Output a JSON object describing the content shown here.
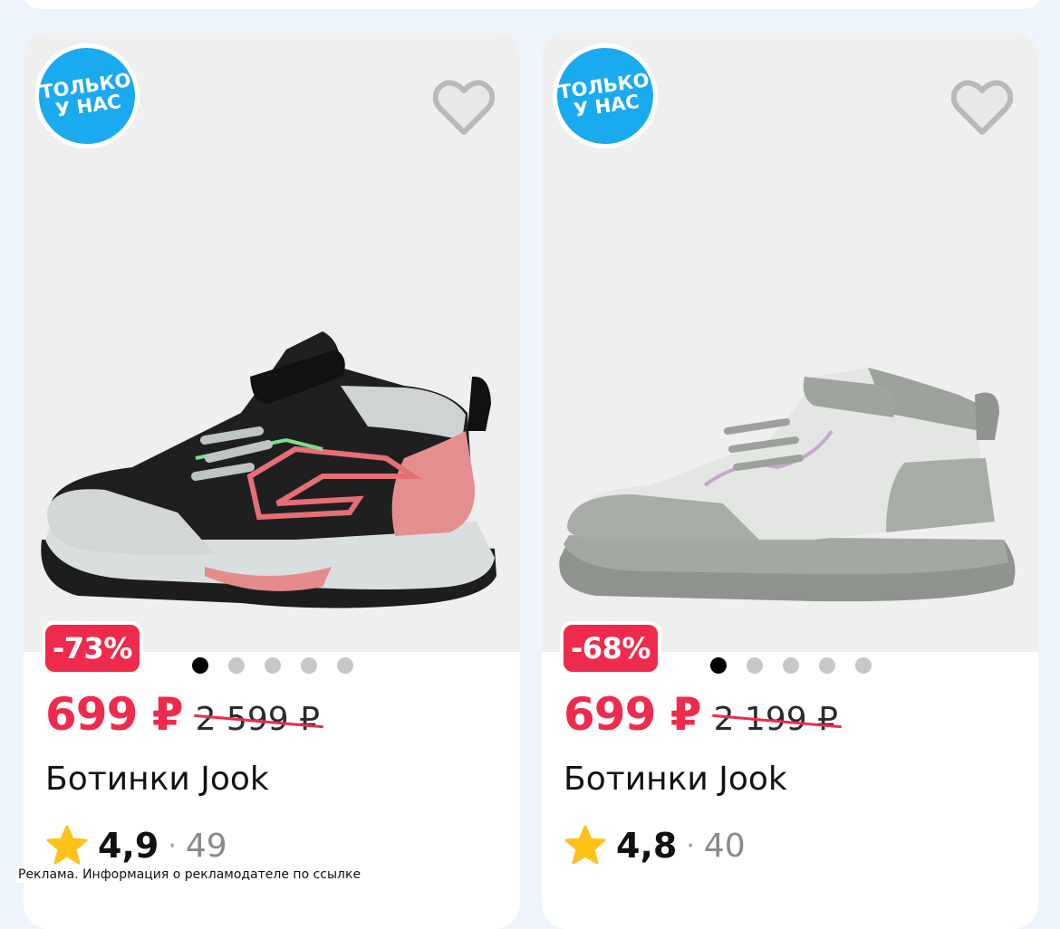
{
  "ad_note": "Реклама. Информация о рекламодателе по ссылке",
  "colors": {
    "accent_red": "#ee2b4d",
    "badge_blue": "#1aaaf0",
    "star_yellow": "#ffc21a"
  },
  "cards": [
    {
      "badge_line1": "ТОЛЬКО",
      "badge_line2": "У НАС",
      "discount": "-73%",
      "price": "699 ₽",
      "old_price": "2 599 ₽",
      "title": "Ботинки Jook",
      "rating": "4,9",
      "separator": "·",
      "reviews": "49",
      "image_count": 5,
      "active_image": 1,
      "icon": "heart-outline-icon"
    },
    {
      "badge_line1": "ТОЛЬКО",
      "badge_line2": "У НАС",
      "discount": "-68%",
      "price": "699 ₽",
      "old_price": "2 199 ₽",
      "title": "Ботинки Jook",
      "rating": "4,8",
      "separator": "·",
      "reviews": "40",
      "image_count": 5,
      "active_image": 1,
      "icon": "heart-outline-icon"
    }
  ]
}
